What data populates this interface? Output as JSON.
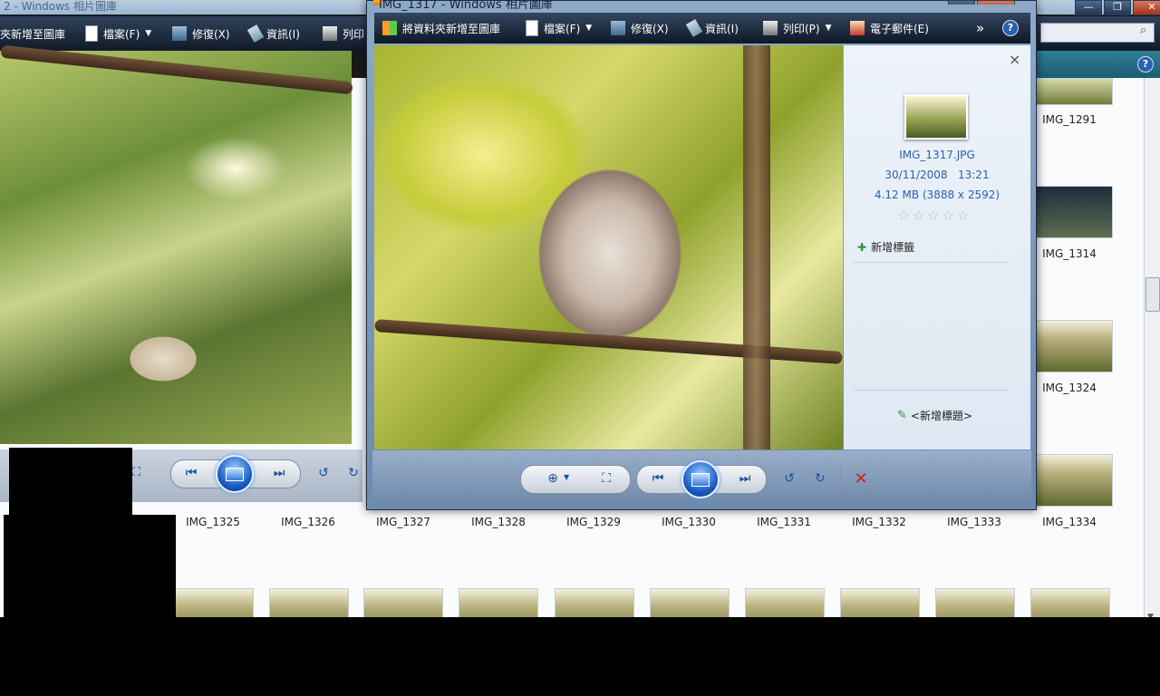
{
  "background_window": {
    "title": "2 - Windows 相片圖庫",
    "toolbar": {
      "add_folder": "夾新增至圖庫",
      "file": "檔案(F)",
      "fix": "修復(X)",
      "info": "資訊(I)",
      "print": "列印"
    },
    "row1": [
      {
        "label": "IMG_1325"
      },
      {
        "label": "IMG_1326"
      },
      {
        "label": "IMG_1327"
      },
      {
        "label": "IMG_1328"
      },
      {
        "label": "IMG_1329"
      },
      {
        "label": "IMG_1330"
      },
      {
        "label": "IMG_1331"
      },
      {
        "label": "IMG_1332"
      },
      {
        "label": "IMG_1333"
      },
      {
        "label": "IMG_1334"
      }
    ],
    "right_column": [
      {
        "label": "IMG_1291"
      },
      {
        "label": "IMG_1314"
      },
      {
        "label": "IMG_1324"
      }
    ],
    "help_glyph": "?"
  },
  "window_buttons": {
    "minimize": "—",
    "maximize": "❐",
    "close": "✕"
  },
  "viewer": {
    "title": "IMG_1317 - Windows 相片圖庫",
    "toolbar": {
      "add_folder": "將資料夾新增至圖庫",
      "file": "檔案(F)",
      "fix": "修復(X)",
      "info": "資訊(I)",
      "print": "列印(P)",
      "email": "電子郵件(E)",
      "more": "»",
      "help": "?"
    },
    "info_pane": {
      "close": "×",
      "filename": "IMG_1317.JPG",
      "datetime": "30/11/2008   13:21",
      "size": "4.12 MB (3888 x 2592)",
      "rating": 0,
      "add_tag": "新增標籤",
      "add_caption": "<新增標題>"
    }
  },
  "colors": {
    "accent_blue": "#2a5fb8",
    "toolbar_dark": "#0e1827",
    "delete_red": "#c8221a"
  }
}
